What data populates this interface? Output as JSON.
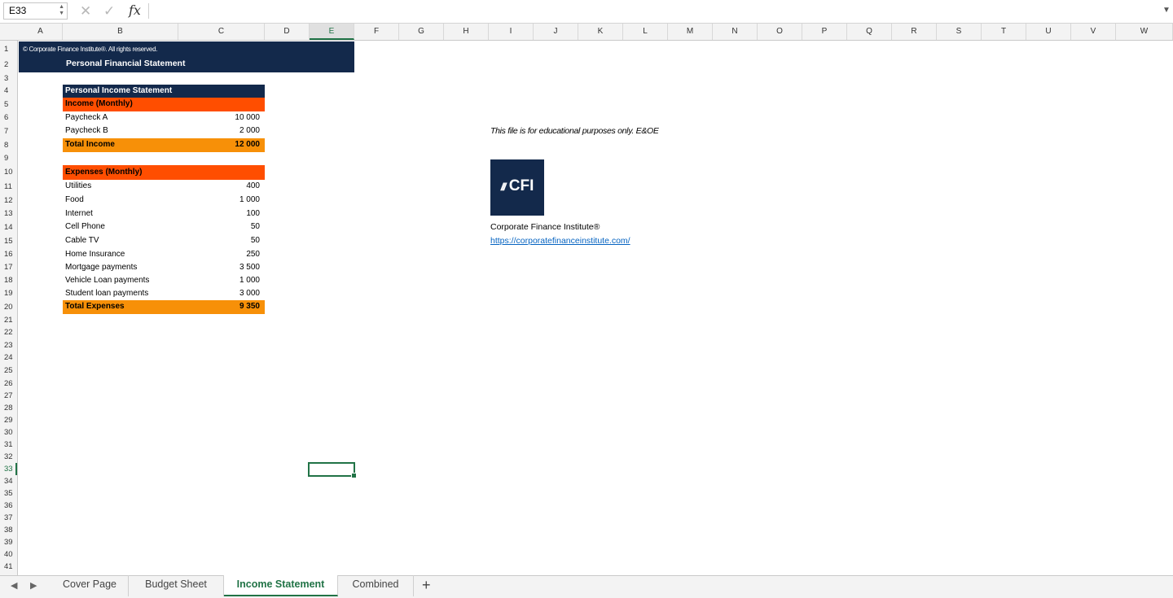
{
  "formula_bar": {
    "name_box": "E33",
    "fx_label": "fx",
    "formula": ""
  },
  "columns": [
    "A",
    "B",
    "C",
    "D",
    "E",
    "F",
    "G",
    "H",
    "I",
    "J",
    "K",
    "L",
    "M",
    "N",
    "O",
    "P",
    "Q",
    "R",
    "S",
    "T",
    "U",
    "V",
    "W"
  ],
  "selected_column": "E",
  "rows": [
    "1",
    "2",
    "3",
    "4",
    "5",
    "6",
    "7",
    "8",
    "9",
    "10",
    "11",
    "12",
    "13",
    "14",
    "15",
    "16",
    "17",
    "18",
    "19",
    "20",
    "21",
    "22",
    "23",
    "24",
    "25",
    "26",
    "27",
    "28",
    "29",
    "30",
    "31",
    "32",
    "33",
    "34",
    "35",
    "36",
    "37",
    "38",
    "39",
    "40",
    "41"
  ],
  "selected_row": "33",
  "sheet": {
    "copyright": "© Corporate Finance Institute®. All rights reserved.",
    "title": "Personal Financial Statement",
    "income_statement_title": "Personal Income Statement",
    "income_header": "Income (Monthly)",
    "income": [
      {
        "label": "Paycheck A",
        "value": "10 000"
      },
      {
        "label": "Paycheck B",
        "value": "2 000"
      }
    ],
    "total_income": {
      "label": "Total Income",
      "value": "12 000"
    },
    "expenses_header": "Expenses (Monthly)",
    "expenses": [
      {
        "label": "Utilities",
        "value": "400"
      },
      {
        "label": "Food",
        "value": "1 000"
      },
      {
        "label": "Internet",
        "value": "100"
      },
      {
        "label": "Cell Phone",
        "value": "50"
      },
      {
        "label": "Cable TV",
        "value": "50"
      },
      {
        "label": "Home Insurance",
        "value": "250"
      },
      {
        "label": "Mortgage payments",
        "value": "3 500"
      },
      {
        "label": "Vehicle Loan payments",
        "value": "1 000"
      },
      {
        "label": "Student loan payments",
        "value": "3 000"
      }
    ],
    "total_expenses": {
      "label": "Total Expenses",
      "value": "9 350"
    },
    "disclaimer": "This file is for educational purposes only. E&OE",
    "logo_text": "CFI",
    "company_name": "Corporate Finance Institute®",
    "company_url": "https://corporatefinanceinstitute.com/"
  },
  "tabs": [
    {
      "label": "Cover Page",
      "active": false
    },
    {
      "label": "Budget Sheet",
      "active": false
    },
    {
      "label": "Income Statement",
      "active": true
    },
    {
      "label": "Combined",
      "active": false
    }
  ],
  "add_tab_label": "+",
  "colors": {
    "navy": "#13294b",
    "orange": "#ff4e00",
    "amber": "#f79008",
    "excel_green": "#217346",
    "link": "#0563c1"
  }
}
